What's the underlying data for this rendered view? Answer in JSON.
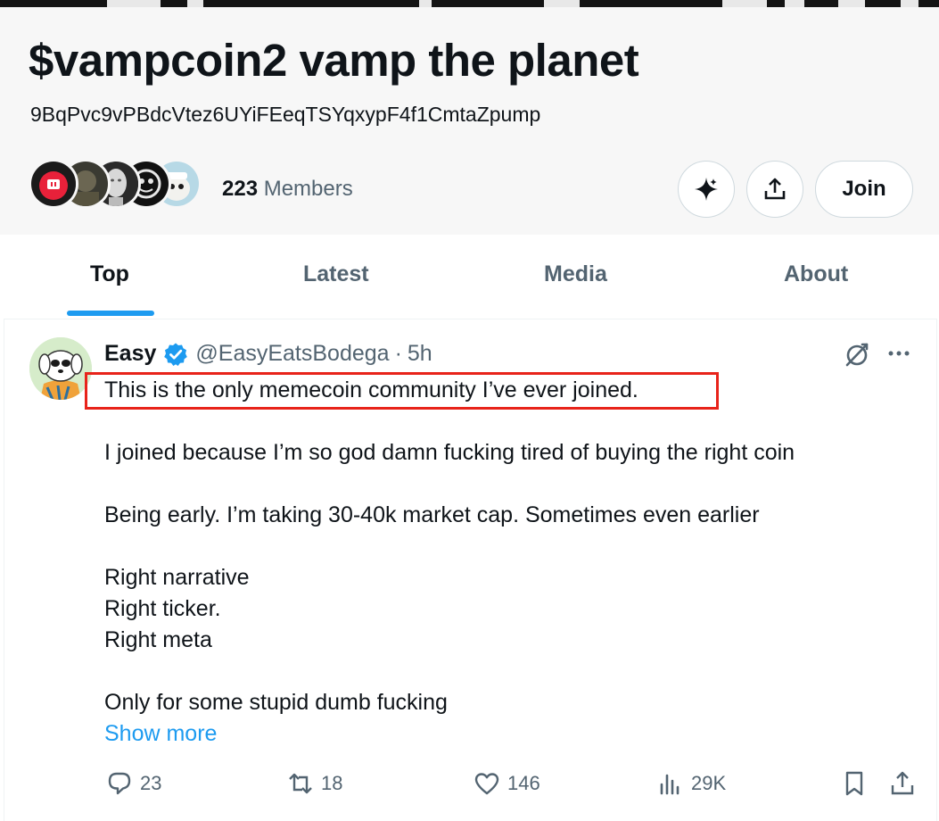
{
  "community": {
    "title": "$vampcoin2 vamp the planet",
    "contract_address": "9BqPvc9vPBdcVtez6UYiFEeqTSYqxypF4f1CmtaZpump",
    "member_count": "223",
    "member_label": "Members",
    "join_label": "Join"
  },
  "tabs": [
    {
      "label": "Top",
      "active": true
    },
    {
      "label": "Latest",
      "active": false
    },
    {
      "label": "Media",
      "active": false
    },
    {
      "label": "About",
      "active": false
    }
  ],
  "post": {
    "author_name": "Easy",
    "author_handle": "@EasyEatsBodega",
    "separator": "·",
    "time": "5h",
    "lines": [
      "This is the only memecoin community I’ve ever joined.",
      "I joined because I’m so god damn fucking tired of buying the right coin",
      "Being early. I’m taking 30-40k market cap. Sometimes even earlier",
      "Right narrative",
      "Right ticker.",
      "Right meta",
      "Only for some stupid dumb fucking"
    ],
    "show_more": "Show more",
    "replies": "23",
    "reposts": "18",
    "likes": "146",
    "views": "29K"
  },
  "colors": {
    "accent": "#1d9bf0",
    "highlight_border": "#e8231a",
    "secondary_text": "#536471",
    "header_bg": "#f7f7f7"
  },
  "icons": [
    "grok-icon",
    "share-icon",
    "verified-badge-icon",
    "grok-post-icon",
    "more-icon",
    "reply-icon",
    "repost-icon",
    "like-icon",
    "views-icon",
    "bookmark-icon",
    "share-post-icon"
  ]
}
